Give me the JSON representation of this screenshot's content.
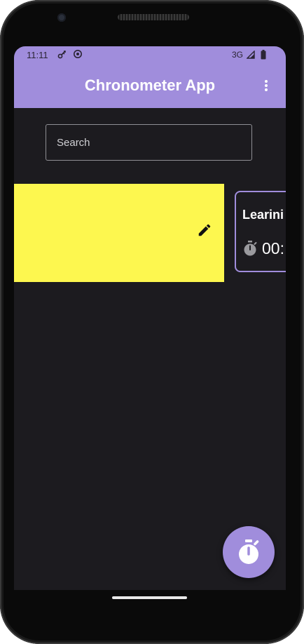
{
  "status_bar": {
    "time": "11:11",
    "network": "3G"
  },
  "app_bar": {
    "title": "Chronometer App"
  },
  "search": {
    "placeholder": "Search"
  },
  "cards": {
    "timer_card": {
      "title": "Learini",
      "time": "00:"
    }
  },
  "colors": {
    "primary": "#a08ddc",
    "background": "#1c1b1f",
    "yellow_card": "#fdf74f"
  },
  "icons": {
    "menu": "more-vert-icon",
    "edit": "pencil-icon",
    "stopwatch": "stopwatch-icon"
  }
}
